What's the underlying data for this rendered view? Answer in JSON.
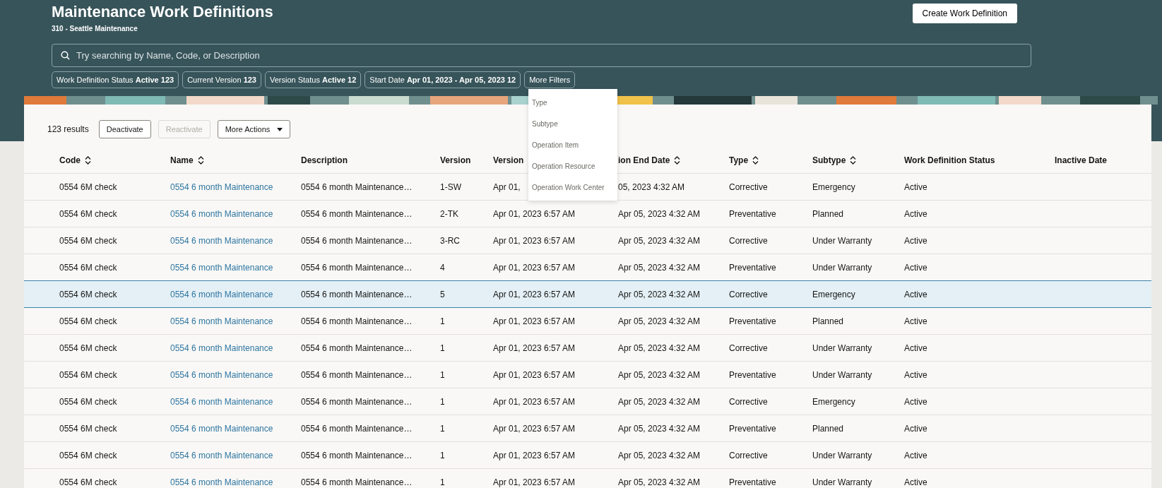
{
  "page": {
    "title": "Maintenance Work Definitions",
    "subtitle": "310 - Seattle Maintenance",
    "create_button": "Create Work Definition"
  },
  "search": {
    "placeholder": "Try searching by Name, Code, or Description"
  },
  "filters": [
    {
      "label": "Work Definition Status",
      "value": "Active 123"
    },
    {
      "label": "Current Version",
      "value": "123"
    },
    {
      "label": "Version Status",
      "value": "Active 12"
    },
    {
      "label": "Start Date",
      "value": "Apr 01, 2023 - Apr 05, 2023 12"
    },
    {
      "label": "More Filters"
    }
  ],
  "more_filters_menu": [
    "Type",
    "Subtype",
    "Operation Item",
    "Operation Resource",
    "Operation Work Center"
  ],
  "toolbar": {
    "results": "123 results",
    "buttons": [
      {
        "label": "Deactivate",
        "disabled": false
      },
      {
        "label": "Reactivate",
        "disabled": true
      },
      {
        "label": "More Actions",
        "disabled": false,
        "kind": "menu"
      }
    ]
  },
  "table": {
    "columns": [
      {
        "label": "Code",
        "sortable": true
      },
      {
        "label": "Name",
        "sortable": true
      },
      {
        "label": "Description",
        "sortable": false
      },
      {
        "label": "Version",
        "sortable": false
      },
      {
        "label": "Version",
        "sortable": false
      },
      {
        "label": "ion End Date",
        "sortable": true
      },
      {
        "label": "Type",
        "sortable": true
      },
      {
        "label": "Subtype",
        "sortable": true
      },
      {
        "label": "Work Definition Status",
        "sortable": false
      },
      {
        "label": "Inactive Date",
        "sortable": false
      }
    ],
    "rows": [
      {
        "selected": false,
        "cells": [
          "0554 6M check",
          "0554 6 month Maintenance",
          "0554 6 month Maintenance…",
          "1-SW",
          "Apr 01,",
          "05, 2023 4:32 AM",
          "Corrective",
          "Emergency",
          "Active"
        ]
      },
      {
        "selected": false,
        "cells": [
          "0554 6M check",
          "0554 6 month Maintenance",
          "0554 6 month Maintenance…",
          "2-TK",
          "Apr 01, 2023 6:57 AM",
          "Apr 05, 2023 4:32 AM",
          "Preventative",
          "Planned",
          "Active"
        ]
      },
      {
        "selected": false,
        "cells": [
          "0554 6M check",
          "0554 6 month Maintenance",
          "0554 6 month Maintenance…",
          "3-RC",
          "Apr 01, 2023 6:57 AM",
          "Apr 05, 2023 4:32 AM",
          "Corrective",
          "Under Warranty",
          "Active"
        ]
      },
      {
        "selected": false,
        "cells": [
          "0554 6M check",
          "0554 6 month Maintenance",
          "0554 6 month Maintenance…",
          "4",
          "Apr 01, 2023 6:57 AM",
          "Apr 05, 2023 4:32 AM",
          "Preventative",
          "Under Warranty",
          "Active"
        ]
      },
      {
        "selected": true,
        "cells": [
          "0554 6M check",
          "0554 6 month Maintenance",
          "0554 6 month Maintenance…",
          "5",
          "Apr 01, 2023 6:57 AM",
          "Apr 05, 2023 4:32 AM",
          "Corrective",
          "Emergency",
          "Active"
        ]
      },
      {
        "selected": false,
        "cells": [
          "0554 6M check",
          "0554 6 month Maintenance",
          "0554 6 month Maintenance…",
          "1",
          "Apr 01, 2023 6:57 AM",
          "Apr 05, 2023 4:32 AM",
          "Preventative",
          "Planned",
          "Active"
        ]
      },
      {
        "selected": false,
        "cells": [
          "0554 6M check",
          "0554 6 month Maintenance",
          "0554 6 month Maintenance…",
          "1",
          "Apr 01, 2023 6:57 AM",
          "Apr 05, 2023 4:32 AM",
          "Corrective",
          "Under Warranty",
          "Active"
        ]
      },
      {
        "selected": false,
        "cells": [
          "0554 6M check",
          "0554 6 month Maintenance",
          "0554 6 month Maintenance…",
          "1",
          "Apr 01, 2023 6:57 AM",
          "Apr 05, 2023 4:32 AM",
          "Preventative",
          "Under Warranty",
          "Active"
        ]
      },
      {
        "selected": false,
        "cells": [
          "0554 6M check",
          "0554 6 month Maintenance",
          "0554 6 month Maintenance…",
          "1",
          "Apr 01, 2023 6:57 AM",
          "Apr 05, 2023 4:32 AM",
          "Corrective",
          "Emergency",
          "Active"
        ]
      },
      {
        "selected": false,
        "cells": [
          "0554 6M check",
          "0554 6 month Maintenance",
          "0554 6 month Maintenance…",
          "1",
          "Apr 01, 2023 6:57 AM",
          "Apr 05, 2023 4:32 AM",
          "Preventative",
          "Planned",
          "Active"
        ]
      },
      {
        "selected": false,
        "cells": [
          "0554 6M check",
          "0554 6 month Maintenance",
          "0554 6 month Maintenance…",
          "1",
          "Apr 01, 2023 6:57 AM",
          "Apr 05, 2023 4:32 AM",
          "Corrective",
          "Under Warranty",
          "Active"
        ]
      },
      {
        "selected": false,
        "cells": [
          "0554 6M check",
          "0554 6 month Maintenance",
          "0554 6 month Maintenance…",
          "1",
          "Apr 01, 2023 6:57 AM",
          "Apr 05, 2023 4:32 AM",
          "Preventative",
          "Under Warranty",
          "Active"
        ]
      }
    ]
  }
}
